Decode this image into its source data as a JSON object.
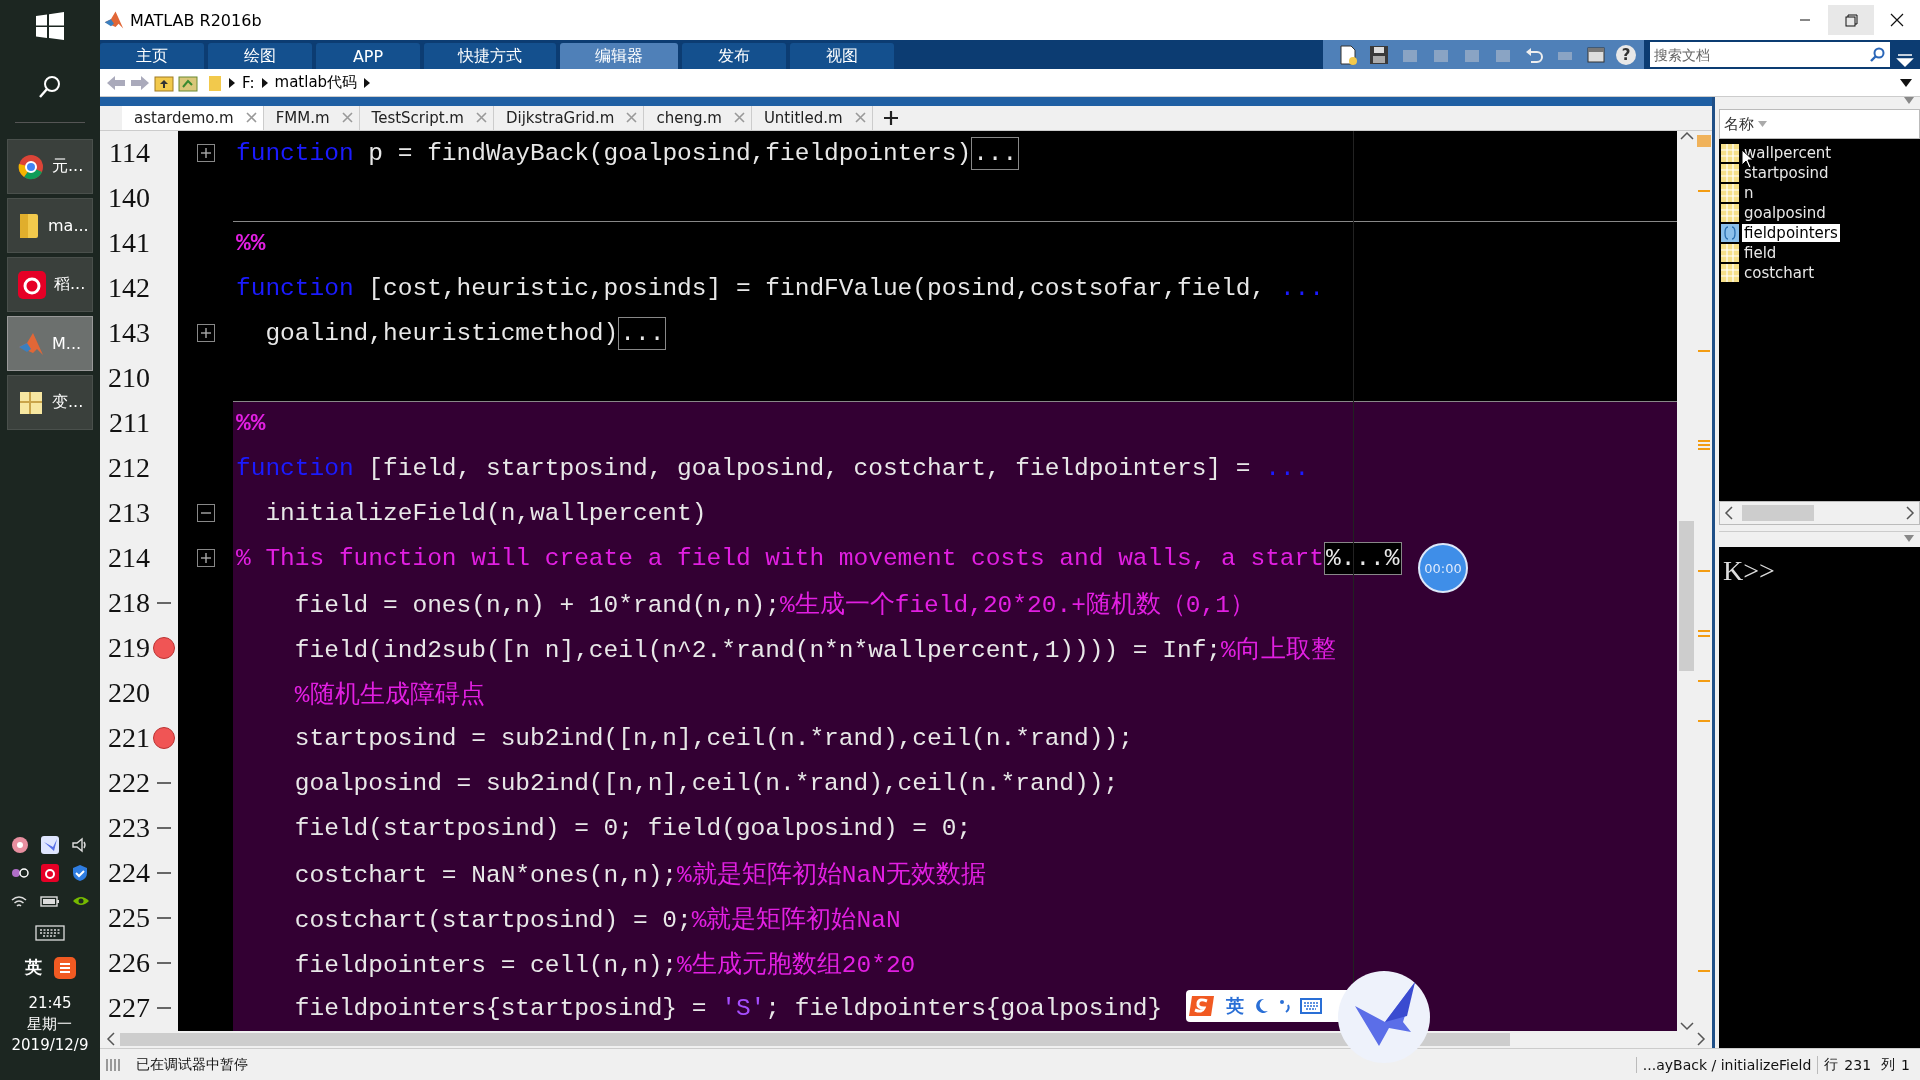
{
  "taskbar": {
    "apps": [
      {
        "label": "元...",
        "kind": "browser",
        "selected": false
      },
      {
        "label": "ma...",
        "kind": "folder",
        "selected": false
      },
      {
        "label": "稻...",
        "kind": "music",
        "selected": false
      },
      {
        "label": "M...",
        "kind": "matlab",
        "selected": true
      },
      {
        "label": "变...",
        "kind": "notes",
        "selected": false
      }
    ],
    "input_mode": "英",
    "time": "21:45",
    "weekday": "星期一",
    "date": "2019/12/9"
  },
  "window": {
    "title": "MATLAB R2016b"
  },
  "ribbon_tabs": [
    {
      "label": "主页",
      "selected": false
    },
    {
      "label": "绘图",
      "selected": false
    },
    {
      "label": "APP",
      "selected": false
    },
    {
      "label": "快捷方式",
      "selected": false
    },
    {
      "label": "编辑器",
      "selected": true
    },
    {
      "label": "发布",
      "selected": false
    },
    {
      "label": "视图",
      "selected": false
    }
  ],
  "help": "?",
  "search": {
    "placeholder": "搜索文档"
  },
  "path": [
    "F:",
    "matlab代码"
  ],
  "editor_tabs": [
    {
      "label": "astardemo.m",
      "selected": true
    },
    {
      "label": "FMM.m",
      "selected": false
    },
    {
      "label": "TestScript.m",
      "selected": false
    },
    {
      "label": "DijkstraGrid.m",
      "selected": false
    },
    {
      "label": "cheng.m",
      "selected": false
    },
    {
      "label": "Untitled.m",
      "selected": false
    }
  ],
  "lines": [
    {
      "number": "114",
      "in_cell": false,
      "section_break": false,
      "breakpoint": false,
      "executable": false,
      "foldable": true,
      "collapsed": true,
      "segments": [
        {
          "kind": "keyword",
          "text": "function"
        },
        {
          "kind": "normal",
          "text": " p = findWayBack(goalposind,fieldpointers)"
        },
        {
          "kind": "folded",
          "text": "..."
        }
      ]
    },
    {
      "number": "140",
      "in_cell": false,
      "section_break": false,
      "breakpoint": false,
      "executable": false,
      "foldable": false
    },
    {
      "number": "141",
      "in_cell": false,
      "section_break": true,
      "breakpoint": false,
      "executable": false,
      "foldable": false,
      "segments": [
        {
          "kind": "section",
          "text": "%%"
        }
      ]
    },
    {
      "number": "142",
      "in_cell": false,
      "section_break": false,
      "breakpoint": false,
      "executable": false,
      "foldable": false,
      "segments": [
        {
          "kind": "keyword",
          "text": "function"
        },
        {
          "kind": "normal",
          "text": " [cost,heuristic,posinds] = findFValue(posind,costsofar,field, "
        },
        {
          "kind": "keyword",
          "text": "..."
        }
      ]
    },
    {
      "number": "143",
      "in_cell": false,
      "section_break": false,
      "breakpoint": false,
      "executable": false,
      "foldable": true,
      "collapsed": true,
      "segments": [
        {
          "kind": "normal",
          "text": "  goalind,heuristicmethod)"
        },
        {
          "kind": "folded",
          "text": "..."
        }
      ]
    },
    {
      "number": "210",
      "in_cell": false,
      "section_break": false,
      "breakpoint": false,
      "executable": false,
      "foldable": false
    },
    {
      "number": "211",
      "in_cell": true,
      "section_break": true,
      "breakpoint": false,
      "executable": false,
      "foldable": false,
      "segments": [
        {
          "kind": "section",
          "text": "%%"
        }
      ]
    },
    {
      "number": "212",
      "in_cell": true,
      "section_break": false,
      "breakpoint": false,
      "executable": false,
      "foldable": false,
      "segments": [
        {
          "kind": "keyword",
          "text": "function"
        },
        {
          "kind": "normal",
          "text": " [field, startposind, goalposind, costchart, fieldpointers] = "
        },
        {
          "kind": "keyword",
          "text": "..."
        }
      ]
    },
    {
      "number": "213",
      "in_cell": true,
      "section_break": false,
      "breakpoint": false,
      "executable": false,
      "foldable": true,
      "collapsed": false,
      "segments": [
        {
          "kind": "normal",
          "text": "  initializeField(n,wallpercent)"
        }
      ]
    },
    {
      "number": "214",
      "in_cell": true,
      "section_break": false,
      "breakpoint": false,
      "executable": false,
      "foldable": true,
      "collapsed": true,
      "segments": [
        {
          "kind": "comment",
          "text": "% This function will create a field with movement costs and walls, a start"
        },
        {
          "kind": "folded",
          "text": "%...%"
        }
      ]
    },
    {
      "number": "218",
      "in_cell": true,
      "section_break": false,
      "breakpoint": false,
      "executable": true,
      "foldable": false,
      "segments": [
        {
          "kind": "normal",
          "text": "    field = ones(n,n) + 10*rand(n,n);"
        },
        {
          "kind": "comment",
          "text": "%生成一个field,20*20.+随机数（0,1）"
        }
      ]
    },
    {
      "number": "219",
      "in_cell": true,
      "section_break": false,
      "breakpoint": true,
      "executable": true,
      "foldable": false,
      "segments": [
        {
          "kind": "normal",
          "text": "    field(ind2sub([n n],ceil(n^2.*rand(n*n*wallpercent,1)))) = Inf;"
        },
        {
          "kind": "comment",
          "text": "%向上取整"
        }
      ]
    },
    {
      "number": "220",
      "in_cell": true,
      "section_break": false,
      "breakpoint": false,
      "executable": false,
      "foldable": false,
      "segments": [
        {
          "kind": "comment",
          "text": "    %随机生成障碍点"
        }
      ]
    },
    {
      "number": "221",
      "in_cell": true,
      "section_break": false,
      "breakpoint": true,
      "executable": true,
      "foldable": false,
      "segments": [
        {
          "kind": "normal",
          "text": "    startposind = sub2ind([n,n],ceil(n.*rand),ceil(n.*rand));"
        }
      ]
    },
    {
      "number": "222",
      "in_cell": true,
      "section_break": false,
      "breakpoint": false,
      "executable": true,
      "foldable": false,
      "segments": [
        {
          "kind": "normal",
          "text": "    goalposind = sub2ind([n,n],ceil(n.*rand),ceil(n.*rand));"
        }
      ]
    },
    {
      "number": "223",
      "in_cell": true,
      "section_break": false,
      "breakpoint": false,
      "executable": true,
      "foldable": false,
      "segments": [
        {
          "kind": "normal",
          "text": "    field(startposind) = 0; field(goalposind) = 0;"
        }
      ]
    },
    {
      "number": "224",
      "in_cell": true,
      "section_break": false,
      "breakpoint": false,
      "executable": true,
      "foldable": false,
      "segments": [
        {
          "kind": "normal",
          "text": "    costchart = NaN*ones(n,n);"
        },
        {
          "kind": "comment",
          "text": "%就是矩阵初始NaN无效数据"
        }
      ]
    },
    {
      "number": "225",
      "in_cell": true,
      "section_break": false,
      "breakpoint": false,
      "executable": true,
      "foldable": false,
      "segments": [
        {
          "kind": "normal",
          "text": "    costchart(startposind) = 0;"
        },
        {
          "kind": "comment",
          "text": "%就是矩阵初始NaN"
        }
      ]
    },
    {
      "number": "226",
      "in_cell": true,
      "section_break": false,
      "breakpoint": false,
      "executable": true,
      "foldable": false,
      "segments": [
        {
          "kind": "normal",
          "text": "    fieldpointers = cell(n,n);"
        },
        {
          "kind": "comment",
          "text": "%生成元胞数组20*20"
        }
      ]
    },
    {
      "number": "227",
      "in_cell": true,
      "section_break": false,
      "breakpoint": false,
      "executable": true,
      "foldable": false,
      "segments": [
        {
          "kind": "normal",
          "text": "    fieldpointers{startposind} = "
        },
        {
          "kind": "string",
          "text": "'S'"
        },
        {
          "kind": "normal",
          "text": "; fieldpointers{goalposind}"
        }
      ]
    }
  ],
  "workspace": {
    "header": "名称",
    "items": [
      {
        "name": "wallpercent",
        "kind": "matrix",
        "selected": false
      },
      {
        "name": "startposind",
        "kind": "matrix",
        "selected": false
      },
      {
        "name": "n",
        "kind": "matrix",
        "selected": false
      },
      {
        "name": "goalposind",
        "kind": "matrix",
        "selected": false
      },
      {
        "name": "fieldpointers",
        "kind": "cell",
        "selected": true
      },
      {
        "name": "field",
        "kind": "matrix",
        "selected": false
      },
      {
        "name": "costchart",
        "kind": "matrix",
        "selected": false
      }
    ]
  },
  "command_window": {
    "prompt": "K>>"
  },
  "timer": "00:00",
  "ime": {
    "mode": "英"
  },
  "status_bar": {
    "message": "已在调试器中暂停",
    "function": "...ayBack / initializeField",
    "line_label": "行",
    "line": "231",
    "column_label": "列",
    "column": "1"
  }
}
